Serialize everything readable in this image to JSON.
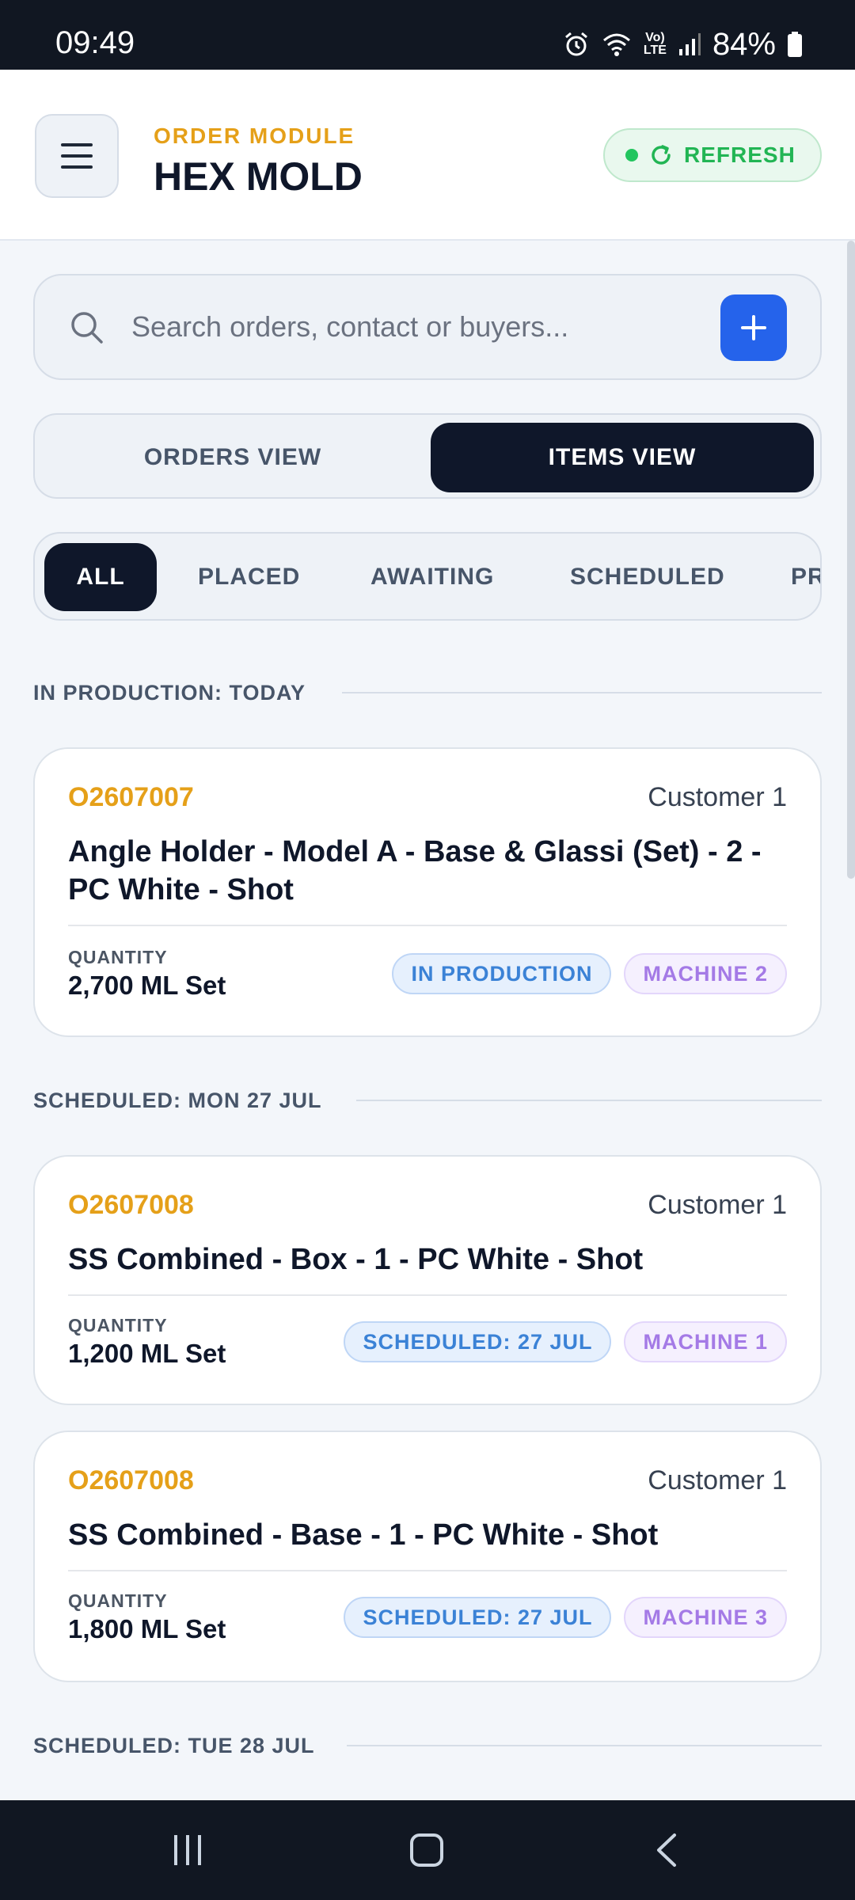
{
  "status_bar": {
    "time": "09:49",
    "battery": "84%",
    "icons": [
      "alarm-icon",
      "wifi-icon",
      "volte-icon",
      "signal-icon",
      "battery-icon"
    ],
    "lte_label_top": "Vo)",
    "lte_label_bottom": "LTE"
  },
  "header": {
    "module_label": "ORDER MODULE",
    "title": "HEX MOLD",
    "refresh_label": "REFRESH",
    "menu_icon": "hamburger-menu-icon"
  },
  "search": {
    "placeholder": "Search orders, contact or buyers...",
    "value": ""
  },
  "view_toggle": {
    "options": [
      "ORDERS VIEW",
      "ITEMS VIEW"
    ],
    "selected": "ITEMS VIEW"
  },
  "filters": {
    "chips": [
      "ALL",
      "PLACED",
      "AWAITING",
      "SCHEDULED",
      "PR"
    ],
    "selected": "ALL"
  },
  "sections": [
    {
      "label": "IN PRODUCTION: TODAY",
      "items": [
        {
          "order_no": "O2607007",
          "customer": "Customer 1",
          "title": "Angle Holder - Model A - Base & Glassi (Set) - 2 - PC White - Shot",
          "qty_label": "QUANTITY",
          "qty": "2,700 ML Set",
          "status": "IN PRODUCTION",
          "machine": "MACHINE 2"
        }
      ]
    },
    {
      "label": "SCHEDULED: MON 27 JUL",
      "items": [
        {
          "order_no": "O2607008",
          "customer": "Customer 1",
          "title": "SS Combined - Box - 1 - PC White - Shot",
          "qty_label": "QUANTITY",
          "qty": "1,200 ML Set",
          "status": "SCHEDULED: 27 JUL",
          "machine": "MACHINE 1"
        },
        {
          "order_no": "O2607008",
          "customer": "Customer 1",
          "title": "SS Combined - Base - 1 - PC White - Shot",
          "qty_label": "QUANTITY",
          "qty": "1,800 ML Set",
          "status": "SCHEDULED: 27 JUL",
          "machine": "MACHINE 3"
        }
      ]
    },
    {
      "label": "SCHEDULED: TUE 28 JUL",
      "items": []
    }
  ],
  "colors": {
    "accent_orange": "#e5a019",
    "primary_dark": "#0f172a",
    "primary_blue": "#2563eb",
    "success_green": "#22c55e",
    "status_blue": "#3b82d6",
    "machine_purple": "#a47ae6"
  },
  "nav_bar": {
    "icons": [
      "recent-apps-icon",
      "home-icon",
      "back-icon"
    ]
  }
}
